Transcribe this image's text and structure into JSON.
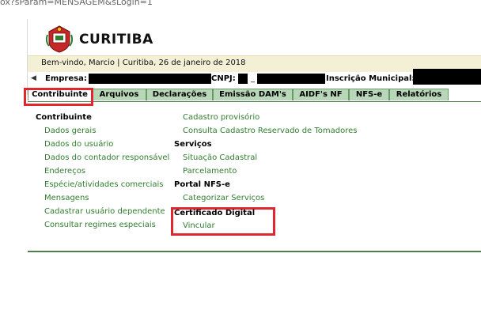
{
  "address_bar": {
    "url_fragment": "ox?sParam=MENSAGEM&sLogin=1"
  },
  "header": {
    "city": "CURITIBA",
    "welcome": "Bem-vindo, Marcio | Curitiba, 26 de janeiro de 2018"
  },
  "company_bar": {
    "empresa_label": "Empresa:",
    "cnpj_label": "CNPJ:",
    "cnpj_value": "_",
    "inscricao_label": "Inscrição Municipal:"
  },
  "tabs": [
    {
      "label": "Contribuinte"
    },
    {
      "label": "Arquivos"
    },
    {
      "label": "Declarações"
    },
    {
      "label": "Emissão DAM's"
    },
    {
      "label": "AIDF's NF"
    },
    {
      "label": "NFS-e"
    },
    {
      "label": "Relatórios"
    }
  ],
  "menu": {
    "col1": {
      "heading": "Contribuinte",
      "links": [
        "Dados gerais",
        "Dados do usuário",
        "Dados do contador responsável",
        "Endereços",
        "Espécie/atividades comerciais",
        "Mensagens",
        "Cadastrar usuário dependente",
        "Consultar regimes especiais"
      ]
    },
    "col2": {
      "top_links": [
        "Cadastro provisório",
        "Consulta Cadastro Reservado de Tomadores"
      ],
      "servicos_heading": "Serviços",
      "servicos_links": [
        "Situação Cadastral",
        "Parcelamento"
      ],
      "portal_heading": "Portal NFS-e",
      "portal_links": [
        "Categorizar Serviços"
      ],
      "cert_heading": "Certificado Digital",
      "cert_links": [
        "Vincular"
      ]
    }
  },
  "colors": {
    "tab_bg": "#b8d6b8",
    "link": "#2f7d2f",
    "highlight": "#e0262e",
    "welcome_bg": "#f3f0d6"
  }
}
